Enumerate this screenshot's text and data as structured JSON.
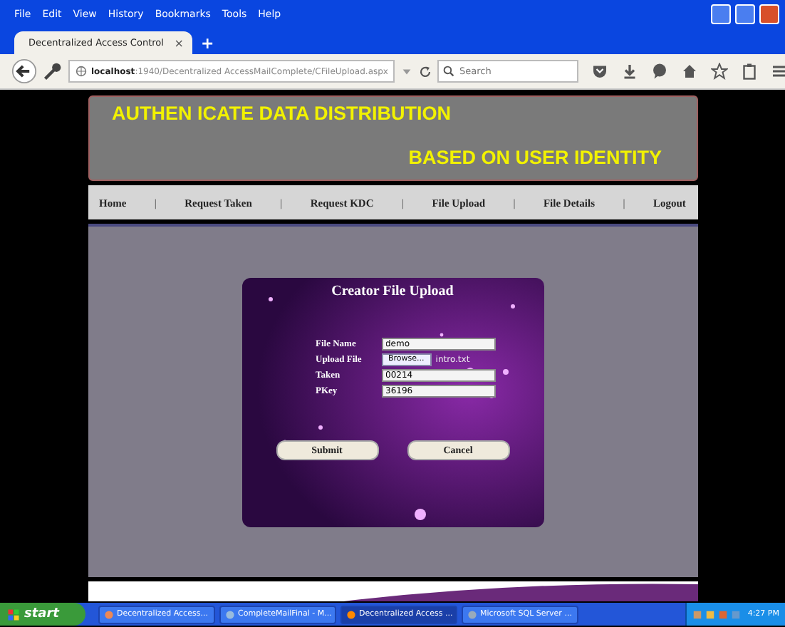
{
  "menu": [
    "File",
    "Edit",
    "View",
    "History",
    "Bookmarks",
    "Tools",
    "Help"
  ],
  "tab": {
    "title": "Decentralized Access Control",
    "close": "×",
    "new": "+"
  },
  "address": {
    "host": "localhost",
    "path": ":1940/Decentralized AccessMailComplete/CFileUpload.aspx"
  },
  "search": {
    "placeholder": "Search"
  },
  "header": {
    "line_1": "AUTHEN ICATE DATA DISTRIBUTION",
    "line_2": "BASED  ON USER IDENTITY"
  },
  "nav": [
    {
      "kind": "link",
      "label": "Home"
    },
    {
      "kind": "separator",
      "label": "|"
    },
    {
      "kind": "link",
      "label": "Request Taken"
    },
    {
      "kind": "separator",
      "label": "|"
    },
    {
      "kind": "link",
      "label": "Request KDC"
    },
    {
      "kind": "separator",
      "label": "|"
    },
    {
      "kind": "link",
      "label": "File Upload"
    },
    {
      "kind": "separator",
      "label": "|"
    },
    {
      "kind": "link",
      "label": "File Details"
    },
    {
      "kind": "separator",
      "label": "|"
    },
    {
      "kind": "link",
      "label": "Logout"
    }
  ],
  "form": {
    "title": "Creator File Upload",
    "fields": [
      {
        "kind": "text",
        "label": "File Name",
        "value": "demo"
      },
      {
        "kind": "file",
        "label": "Upload File",
        "button": "Browse...",
        "value": "intro.txt"
      },
      {
        "kind": "text",
        "label": "Taken",
        "value": "00214"
      },
      {
        "kind": "text",
        "label": "PKey",
        "value": "36196"
      }
    ],
    "buttons": [
      "Submit",
      "Cancel"
    ]
  },
  "taskbar": {
    "start": "start",
    "items": [
      {
        "label": "Decentralized Access...",
        "selected": false
      },
      {
        "label": "CompleteMailFinal - M...",
        "selected": false
      },
      {
        "label": "Decentralized Access ...",
        "selected": true
      },
      {
        "label": "Microsoft SQL Server ...",
        "selected": false
      }
    ],
    "time": "4:27 PM"
  }
}
